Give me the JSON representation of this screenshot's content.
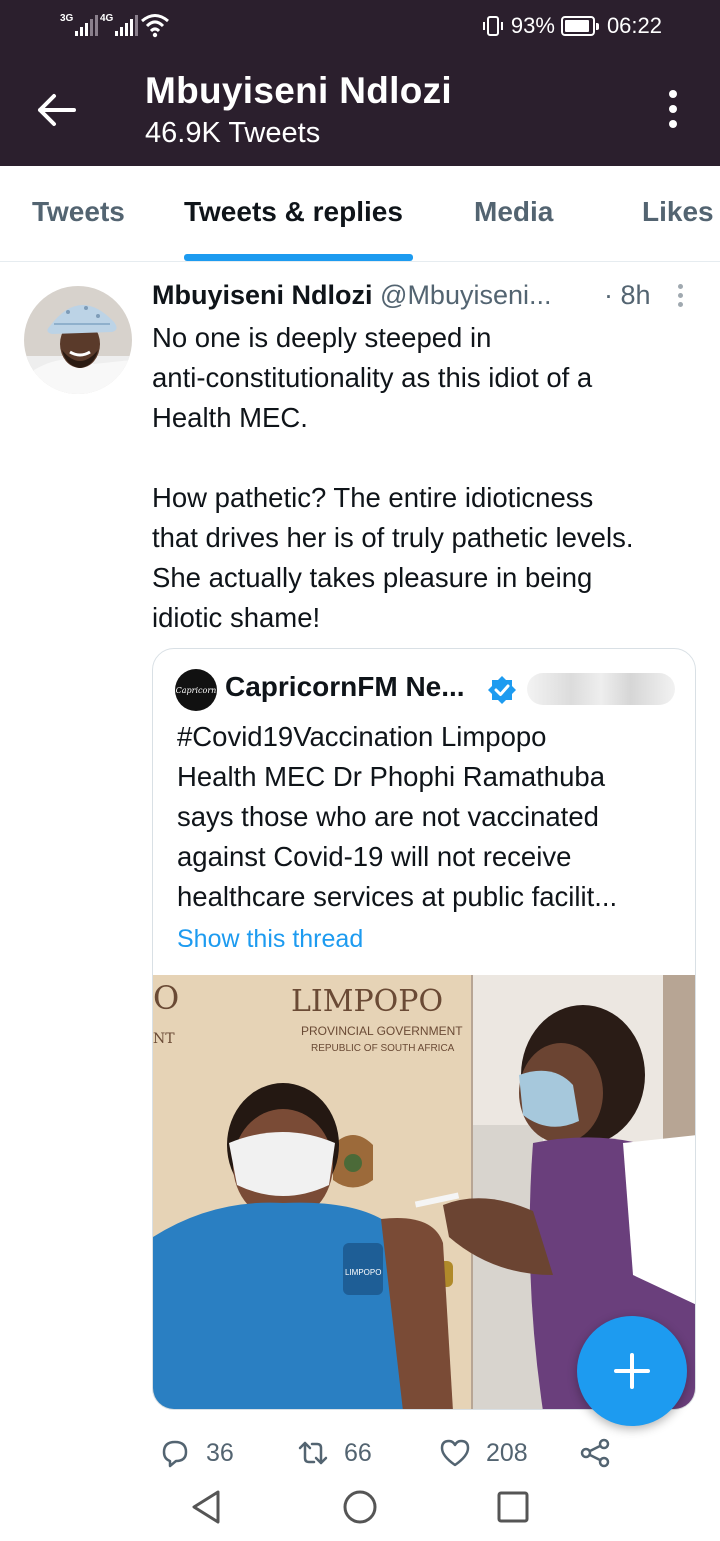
{
  "status_bar": {
    "network_1": "3G",
    "network_2": "4G",
    "battery": "93%",
    "battery_level": 0.93,
    "time": "06:22"
  },
  "header": {
    "title": "Mbuyiseni Ndlozi",
    "subtitle": "46.9K Tweets"
  },
  "tabs": [
    {
      "label": "Tweets",
      "active": false
    },
    {
      "label": "Tweets & replies",
      "active": true
    },
    {
      "label": "Media",
      "active": false
    },
    {
      "label": "Likes",
      "active": false
    }
  ],
  "tweet": {
    "author_name": "Mbuyiseni Ndlozi",
    "author_handle": "@Mbuyiseni...",
    "time": "· 8h",
    "lines": [
      "No one is deeply steeped in",
      "anti-constitutionality as this idiot of a",
      "Health MEC.",
      "",
      "How pathetic? The entire idioticness",
      "that drives her is of truly pathetic levels.",
      "She actually takes pleasure in being",
      "idiotic shame!"
    ],
    "quote": {
      "logo_text": "Capricorn",
      "author_name": "CapricornFM Ne...",
      "lines": [
        "#Covid19Vaccination Limpopo",
        "Health MEC Dr Phophi Ramathuba",
        "says those who are not vaccinated",
        "against Covid-19 will not receive",
        "healthcare services at public facilit..."
      ],
      "link": "Show this thread",
      "photo": {
        "banner_title": "LIMPOPO",
        "banner_line1": "PROVINCIAL GOVERNMENT",
        "banner_line2": "REPUBLIC OF SOUTH AFRICA",
        "edge_letter": "O",
        "edge_text": "NT",
        "badge_text": "LIMPOPO"
      }
    },
    "actions": {
      "replies": "36",
      "retweets": "66",
      "likes": "208"
    }
  },
  "colors": {
    "header_bg": "#2b1f2d",
    "accent": "#1d9bf0",
    "secondary_text": "#536471"
  }
}
